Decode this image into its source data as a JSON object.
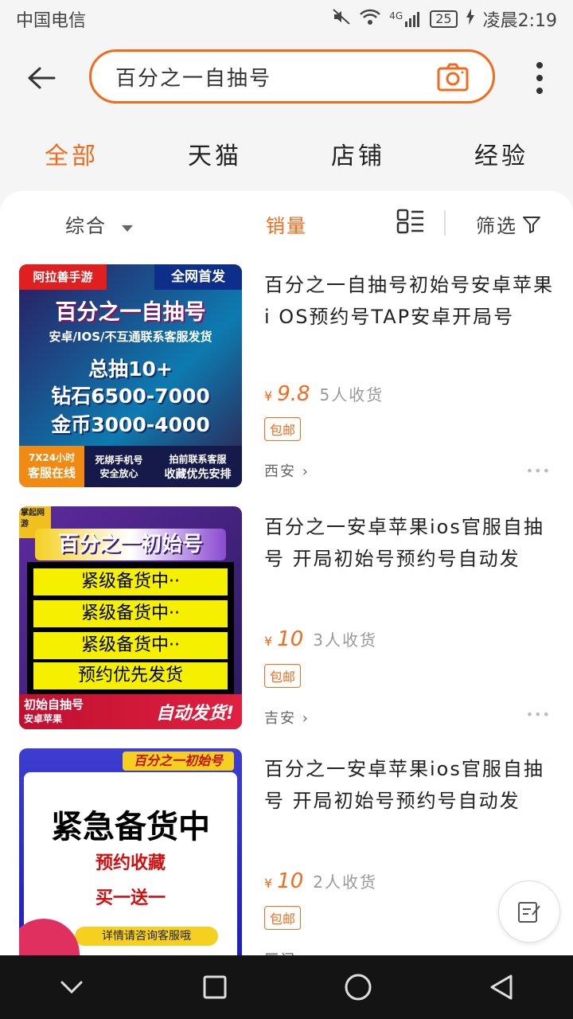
{
  "status": {
    "carrier": "中国电信",
    "battery": "25",
    "time": "凌晨2:19",
    "network": "4G"
  },
  "search": {
    "query": "百分之一自抽号"
  },
  "tabs": [
    "全部",
    "天猫",
    "店铺",
    "经验"
  ],
  "sort": {
    "comprehensive": "综合",
    "sales": "销量",
    "filter": "筛选"
  },
  "items": [
    {
      "title": "百分之一自抽号初始号安卓苹果i OS预约号TAP安卓开局号",
      "currency": "¥",
      "price": "9.8",
      "sold": "5人收货",
      "tag": "包邮",
      "location": "西安",
      "thumb": {
        "shop": "阿拉善手游",
        "badge": "全网首发",
        "line1": "百分之一自抽号",
        "line2": "安卓/IOS/不互通联系客服发货",
        "line3": "总抽10+",
        "line4": "钻石6500-7000",
        "line5": "金币3000-4000",
        "foot1a": "7X24小时",
        "foot1b": "客服在线",
        "foot2a": "死绑手机号",
        "foot2b": "安全放心",
        "foot3a": "拍前联系客服",
        "foot3b": "收藏优先安排"
      }
    },
    {
      "title": "百分之一安卓苹果ios官服自抽号 开局初始号预约号自动发",
      "currency": "¥",
      "price": "10",
      "sold": "3人收货",
      "tag": "包邮",
      "location": "吉安",
      "thumb": {
        "corner": "掌起网游",
        "heading": "百分之一初始号",
        "rows": [
          "紧级备货中··",
          "紧级备货中··",
          "紧级备货中··",
          "预约优先发货"
        ],
        "foot1": "初始自抽号",
        "foot2": "安卓苹果",
        "foot3": "自动发货!"
      }
    },
    {
      "title": "百分之一安卓苹果ios官服自抽号 开局初始号预约号自动发",
      "currency": "¥",
      "price": "10",
      "sold": "2人收货",
      "tag": "包邮",
      "location": "厦门",
      "thumb": {
        "heading": "百分之一初始号",
        "big": "紧急备货中",
        "sub1": "预约收藏",
        "sub2": "买一送一",
        "foot": "详情请咨询客服哦"
      }
    }
  ]
}
